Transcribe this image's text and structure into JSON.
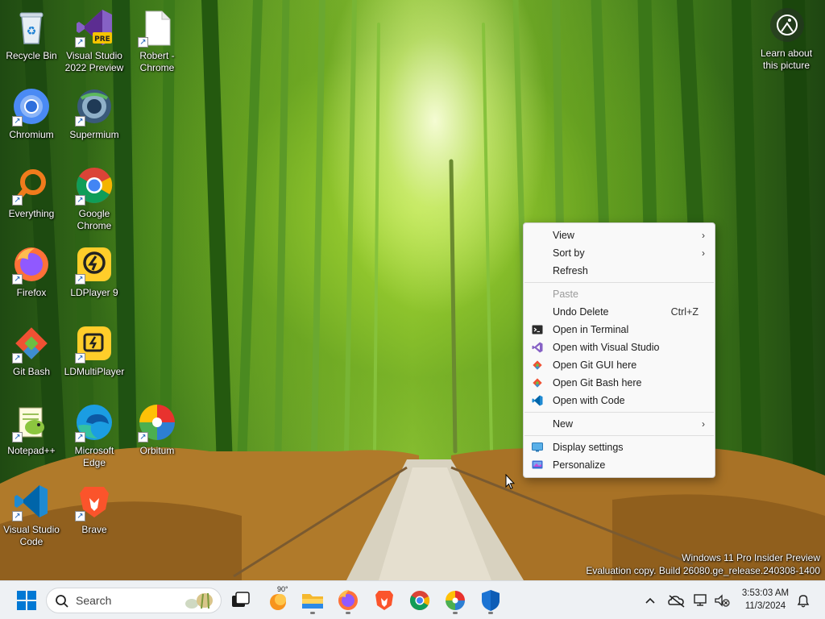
{
  "desktop": {
    "icons": [
      {
        "label": "Recycle Bin",
        "icon": "recycle-bin-icon"
      },
      {
        "label": "Visual Studio 2022 Preview",
        "icon": "visual-studio-preview-icon",
        "badge": "PRE"
      },
      {
        "label": "Robert - Chrome",
        "icon": "blank-document-icon"
      },
      {
        "label": "Chromium",
        "icon": "chromium-icon"
      },
      {
        "label": "Supermium",
        "icon": "supermium-icon"
      },
      {
        "label": "Everything",
        "icon": "everything-search-icon"
      },
      {
        "label": "Google Chrome",
        "icon": "google-chrome-icon"
      },
      {
        "label": "Firefox",
        "icon": "firefox-icon"
      },
      {
        "label": "LDPlayer 9",
        "icon": "ldplayer-icon"
      },
      {
        "label": "Git Bash",
        "icon": "git-bash-icon"
      },
      {
        "label": "LDMultiPlayer",
        "icon": "ldmultiplayer-icon"
      },
      {
        "label": "Notepad++",
        "icon": "notepad-plus-plus-icon"
      },
      {
        "label": "Microsoft Edge",
        "icon": "microsoft-edge-icon"
      },
      {
        "label": "Orbitum",
        "icon": "orbitum-icon"
      },
      {
        "label": "Visual Studio Code",
        "icon": "vscode-icon"
      },
      {
        "label": "Brave",
        "icon": "brave-icon"
      }
    ],
    "learn_about": "Learn about this picture",
    "watermark_line1": "Windows 11 Pro Insider Preview",
    "watermark_line2": "Evaluation copy. Build 26080.ge_release.240308-1400"
  },
  "context_menu": {
    "items": [
      {
        "label": "View",
        "submenu": true
      },
      {
        "label": "Sort by",
        "submenu": true
      },
      {
        "label": "Refresh"
      },
      {
        "label": "Paste",
        "disabled": true
      },
      {
        "label": "Undo Delete",
        "shortcut": "Ctrl+Z"
      },
      {
        "label": "Open in Terminal",
        "icon": "terminal-icon"
      },
      {
        "label": "Open with Visual Studio",
        "icon": "visual-studio-icon"
      },
      {
        "label": "Open Git GUI here",
        "icon": "git-gui-icon"
      },
      {
        "label": "Open Git Bash here",
        "icon": "git-bash-icon"
      },
      {
        "label": "Open with Code",
        "icon": "vscode-icon"
      },
      {
        "label": "New",
        "submenu": true
      },
      {
        "label": "Display settings",
        "icon": "display-settings-icon"
      },
      {
        "label": "Personalize",
        "icon": "personalize-icon"
      }
    ],
    "submenu_glyph": "›"
  },
  "taskbar": {
    "search_placeholder": "Search",
    "weather_temp": "90°",
    "pinned": [
      "start-icon",
      "task-view-icon",
      "weather-icon",
      "file-explorer-icon",
      "firefox-icon",
      "brave-icon",
      "google-chrome-icon",
      "orbitum-icon",
      "windows-defender-icon"
    ],
    "clock_time": "3:53:03 AM",
    "clock_date": "11/3/2024"
  },
  "colors": {
    "accent": "#0078d4",
    "vs_purple": "#8661c5",
    "vscode_blue": "#0065a9",
    "taskbar_bg": "#eef1f4",
    "menu_bg": "#f9f9f9"
  }
}
